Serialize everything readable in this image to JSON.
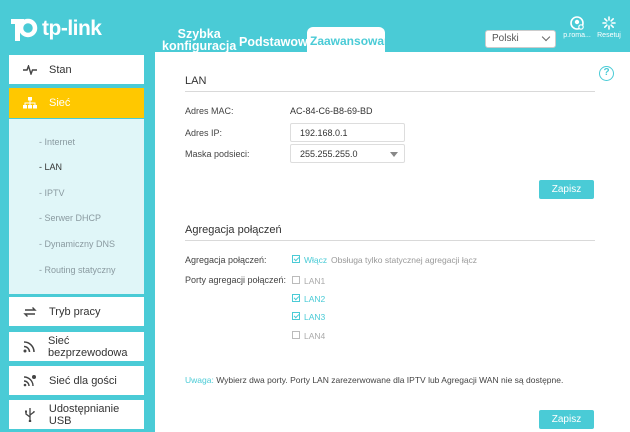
{
  "brand": {
    "logo_text": "tp-link"
  },
  "top_tabs": {
    "quick_setup_line1": "Szybka",
    "quick_setup_line2": "konfiguracja",
    "basic": "Podstawowe",
    "advanced": "Zaawansowane"
  },
  "language": {
    "selected": "Polski"
  },
  "header_buttons": {
    "user": "p.roma...",
    "reset": "Resetuj"
  },
  "sidebar": {
    "items": [
      {
        "label": "Stan",
        "icon": "pulse-icon"
      },
      {
        "label": "Sieć",
        "icon": "network-icon"
      },
      {
        "label": "Tryb pracy",
        "icon": "swap-icon"
      },
      {
        "label": "Sieć bezprzewodowa",
        "icon": "wifi-icon"
      },
      {
        "label": "Sieć dla gości",
        "icon": "guest-icon"
      },
      {
        "label": "Udostępnianie USB",
        "icon": "usb-icon"
      }
    ],
    "sub_items": [
      "- Internet",
      "- LAN",
      "- IPTV",
      "- Serwer DHCP",
      "- Dynamiczny DNS",
      "- Routing statyczny"
    ]
  },
  "lan": {
    "title": "LAN",
    "mac_label": "Adres MAC:",
    "mac_value": "AC-84-C6-B8-69-BD",
    "ip_label": "Adres IP:",
    "ip_value": "192.168.0.1",
    "mask_label": "Maska podsieci:",
    "mask_value": "255.255.255.0",
    "save": "Zapisz"
  },
  "aggregation": {
    "title": "Agregacja połączeń",
    "agg_label": "Agregacja połączeń:",
    "enable_label": "Włącz",
    "enable_hint": "Obsługa tylko statycznej agregacji łącz",
    "ports_label": "Porty agregacji połączeń:",
    "ports": [
      {
        "label": "LAN1",
        "checked": false
      },
      {
        "label": "LAN2",
        "checked": true
      },
      {
        "label": "LAN3",
        "checked": true
      },
      {
        "label": "LAN4",
        "checked": false
      }
    ],
    "note_key": "Uwaga:",
    "note_text": " Wybierz dwa porty. Porty LAN zarezerwowane dla IPTV lub Agregacji WAN nie są dostępne.",
    "save": "Zapisz"
  },
  "colors": {
    "accent": "#4acbd6",
    "active_nav": "#ffc800"
  }
}
